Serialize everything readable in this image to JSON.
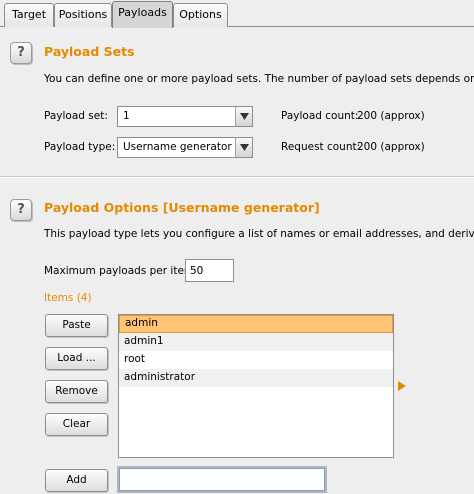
{
  "tabs": [
    {
      "label": "Target",
      "active": false
    },
    {
      "label": "Positions",
      "active": false
    },
    {
      "label": "Payloads",
      "active": true
    },
    {
      "label": "Options",
      "active": false
    }
  ],
  "payload_sets": {
    "help_label": "?",
    "title": "Payload Sets",
    "description": "You can define one or more payload sets. The number of payload sets depends on the at",
    "payload_set_label": "Payload set:",
    "payload_set_value": "1",
    "payload_type_label": "Payload type:",
    "payload_type_value": "Username generator",
    "payload_count_label": "Payload count:",
    "payload_count_value": "200 (approx)",
    "request_count_label": "Request count:",
    "request_count_value": "200 (approx)"
  },
  "payload_options": {
    "help_label": "?",
    "title": "Payload Options [Username generator]",
    "description": "This payload type lets you configure a list of names or email addresses, and derives pote",
    "max_payloads_label": "Maximum payloads per item:",
    "max_payloads_value": "50",
    "items_label": "Items (4)",
    "buttons": {
      "paste": "Paste",
      "load": "Load ...",
      "remove": "Remove",
      "clear": "Clear",
      "add": "Add"
    },
    "items": [
      "admin",
      "admin1",
      "root",
      "administrator"
    ],
    "selected_index": 0,
    "add_input_value": ""
  },
  "colors": {
    "accent": "#e58a00",
    "selection": "#ffc477",
    "background": "#eeeeee"
  }
}
